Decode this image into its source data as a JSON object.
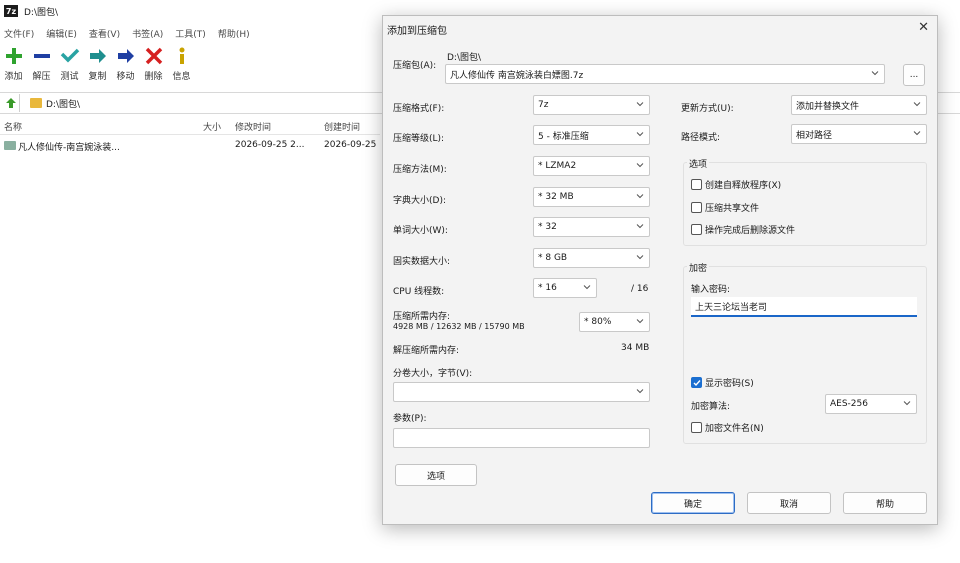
{
  "window": {
    "app_icon_text": "7z",
    "title": "D:\\图包\\"
  },
  "menu": [
    "文件(F)",
    "编辑(E)",
    "查看(V)",
    "书签(A)",
    "工具(T)",
    "帮助(H)"
  ],
  "toolbar": [
    {
      "label": "添加",
      "icon": "add-icon",
      "color": "#2fa32f"
    },
    {
      "label": "解压",
      "icon": "minus-icon",
      "color": "#1f3fa3"
    },
    {
      "label": "测试",
      "icon": "check-icon",
      "color": "#29a3a3"
    },
    {
      "label": "复制",
      "icon": "copy-arrow-icon",
      "color": "#1f8f8f"
    },
    {
      "label": "移动",
      "icon": "move-arrow-icon",
      "color": "#1f3fa3"
    },
    {
      "label": "删除",
      "icon": "delete-x-icon",
      "color": "#d62020"
    },
    {
      "label": "信息",
      "icon": "info-icon",
      "color": "#c9a300"
    }
  ],
  "addressbar": {
    "path": "D:\\图包\\"
  },
  "file_list": {
    "columns": [
      "名称",
      "大小",
      "修改时间",
      "创建时间"
    ],
    "rows": [
      {
        "name": "凡人修仙传-南宫婉泳装...",
        "size": "",
        "modified": "2026-09-25 2...",
        "created": "2026-09-25"
      }
    ]
  },
  "dialog": {
    "title": "添加到压缩包",
    "close": "✕",
    "archive_label": "压缩包(A):",
    "archive_dir": "D:\\图包\\",
    "archive_name": "凡人修仙传 南宫婉泳装白嫖图.7z",
    "browse_label": "...",
    "format_label": "压缩格式(F):",
    "format_value": "7z",
    "level_label": "压缩等级(L):",
    "level_value": "5 - 标准压缩",
    "method_label": "压缩方法(M):",
    "method_value": "* LZMA2",
    "dict_label": "字典大小(D):",
    "dict_value": "* 32 MB",
    "word_label": "单词大小(W):",
    "word_value": "* 32",
    "solid_label": "固实数据大小:",
    "solid_value": "* 8 GB",
    "threads_label": "CPU 线程数:",
    "threads_value": "* 16",
    "threads_max": "/ 16",
    "mem_comp_label": "压缩所需内存:",
    "mem_comp_detail": "4928 MB / 12632 MB / 15790 MB",
    "mem_comp_value": "* 80%",
    "mem_decomp_label": "解压缩所需内存:",
    "mem_decomp_value": "34 MB",
    "split_label": "分卷大小，字节(V):",
    "split_value": "",
    "params_label": "参数(P):",
    "params_value": "",
    "options_btn": "选项",
    "update_label": "更新方式(U):",
    "update_value": "添加并替换文件",
    "path_mode_label": "路径模式:",
    "path_mode_value": "相对路径",
    "options_group": "选项",
    "opt_sfx": "创建自释放程序(X)",
    "opt_shared": "压缩共享文件",
    "opt_delete": "操作完成后删除源文件",
    "encryption_group": "加密",
    "password_label": "输入密码:",
    "password_value": "上天三论坛当老司",
    "show_password": "显示密码(S)",
    "enc_method_label": "加密算法:",
    "enc_method_value": "AES-256",
    "encrypt_names": "加密文件名(N)",
    "ok": "确定",
    "cancel": "取消",
    "help": "帮助"
  }
}
